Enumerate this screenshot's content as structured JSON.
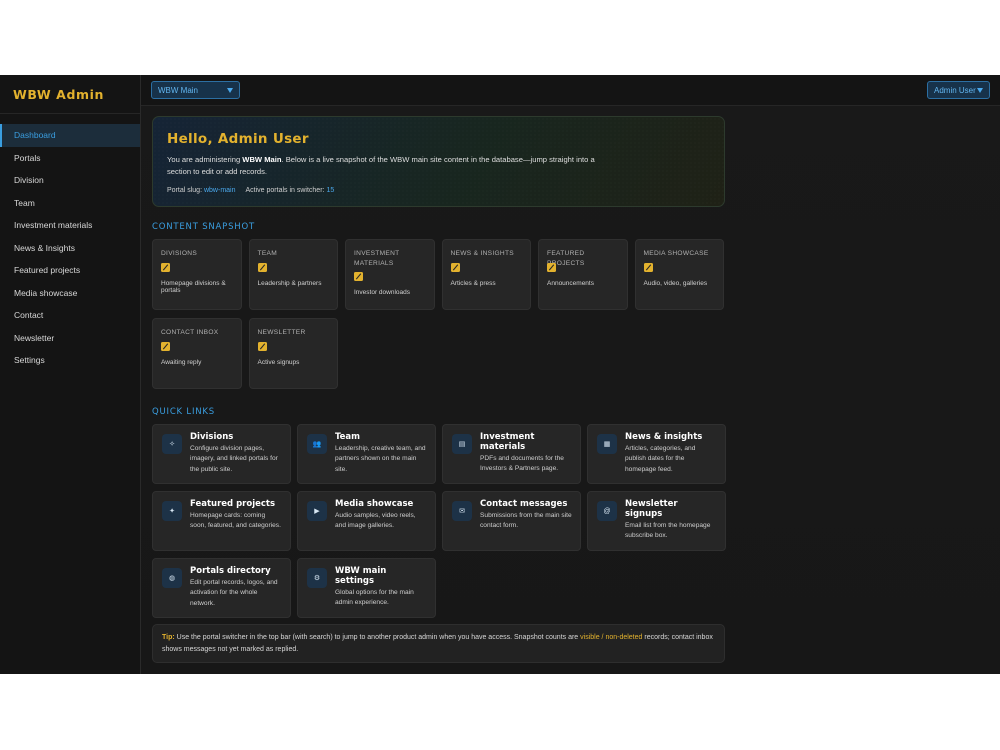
{
  "brand": "WBW Admin",
  "sidebar": {
    "items": [
      {
        "label": "Dashboard",
        "active": true
      },
      {
        "label": "Portals"
      },
      {
        "label": "Division"
      },
      {
        "label": "Team"
      },
      {
        "label": "Investment materials"
      },
      {
        "label": "News & Insights"
      },
      {
        "label": "Featured projects"
      },
      {
        "label": "Media showcase"
      },
      {
        "label": "Contact"
      },
      {
        "label": "Newsletter"
      },
      {
        "label": "Settings"
      }
    ]
  },
  "topbar": {
    "portal_select": "WBW Main",
    "user_menu": "Admin User"
  },
  "hero": {
    "title": "Hello, Admin User",
    "text_before": "You are administering ",
    "text_bold": "WBW Main",
    "text_after": ". Below is a live snapshot of the WBW main site content in the database—jump straight into a section to edit or add records.",
    "slug_label": "Portal slug:",
    "slug_value": "wbw-main",
    "portals_label": "Active portals in switcher:",
    "portals_value": "15"
  },
  "snapshot": {
    "title": "CONTENT SNAPSHOT",
    "cards": [
      {
        "label": "DIVISIONS",
        "sub": "Homepage divisions & portals",
        "icon": "edit-icon"
      },
      {
        "label": "TEAM",
        "sub": "Leadership & partners",
        "icon": "edit-icon"
      },
      {
        "label": "INVESTMENT MATERIALS",
        "sub": "Investor downloads",
        "icon": "edit-icon"
      },
      {
        "label": "NEWS & INSIGHTS",
        "sub": "Articles & press",
        "icon": "edit-icon"
      },
      {
        "label": "FEATURED PROJECTS",
        "sub": "Announcements",
        "icon": "edit-icon"
      },
      {
        "label": "MEDIA SHOWCASE",
        "sub": "Audio, video, galleries",
        "icon": "edit-icon"
      },
      {
        "label": "CONTACT INBOX",
        "sub": "Awaiting reply",
        "icon": "edit-icon"
      },
      {
        "label": "NEWSLETTER",
        "sub": "Active signups",
        "icon": "edit-icon"
      }
    ]
  },
  "quick_links": {
    "title": "QUICK LINKS",
    "items": [
      {
        "title": "Divisions",
        "desc": "Configure division pages, imagery, and linked portals for the public site.",
        "icon": "diamond-icon",
        "glyph": "✧"
      },
      {
        "title": "Team",
        "desc": "Leadership, creative team, and partners shown on the main site.",
        "icon": "people-icon",
        "glyph": "👥"
      },
      {
        "title": "Investment materials",
        "desc": "PDFs and documents for the Investors & Partners page.",
        "icon": "document-icon",
        "glyph": "▤"
      },
      {
        "title": "News & insights",
        "desc": "Articles, categories, and publish dates for the homepage feed.",
        "icon": "newspaper-icon",
        "glyph": "▦"
      },
      {
        "title": "Featured projects",
        "desc": "Homepage cards: coming soon, featured, and categories.",
        "icon": "star-icon",
        "glyph": "✦"
      },
      {
        "title": "Media showcase",
        "desc": "Audio samples, video reels, and image galleries.",
        "icon": "play-icon",
        "glyph": "▶"
      },
      {
        "title": "Contact messages",
        "desc": "Submissions from the main site contact form.",
        "icon": "message-icon",
        "glyph": "✉"
      },
      {
        "title": "Newsletter signups",
        "desc": "Email list from the homepage subscribe box.",
        "icon": "at-icon",
        "glyph": "@"
      },
      {
        "title": "Portals directory",
        "desc": "Edit portal records, logos, and activation for the whole network.",
        "icon": "globe-icon",
        "glyph": "◍"
      },
      {
        "title": "WBW main settings",
        "desc": "Global options for the main admin experience.",
        "icon": "gear-icon",
        "glyph": "⚙"
      }
    ]
  },
  "tip": {
    "label": "Tip:",
    "text1": " Use the portal switcher in the top bar (with search) to jump to another product admin when you have access. Snapshot counts are ",
    "highlight": "visible / non-deleted",
    "text2": " records; contact inbox shows messages not yet marked as replied."
  }
}
